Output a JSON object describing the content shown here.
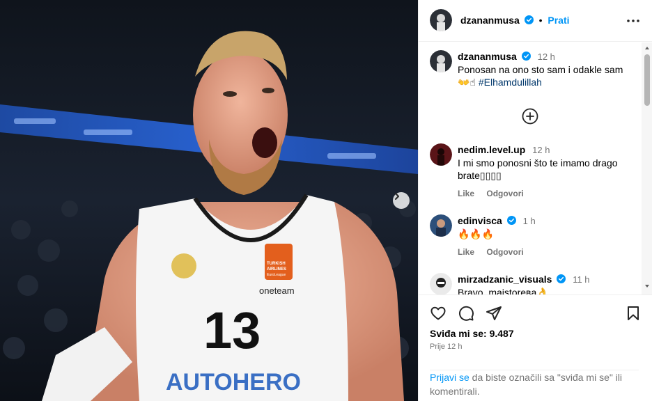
{
  "post": {
    "author": "dzananmusa",
    "follow_label": "Prati",
    "separator": "•",
    "caption_time": "12 h",
    "caption_line1": "Ponosan na ono sto sam i odakle sam",
    "caption_emoji": "👐☝",
    "caption_hashtag": "#Elhamdulillah",
    "media": {
      "jersey_number": "13",
      "sponsor": "AUTOHERO",
      "sponsor2": "oneteam",
      "badge_line1": "TURKISH",
      "badge_line2": "AIRLINES",
      "badge_line3": "EuroLeague"
    }
  },
  "comments": [
    {
      "username": "nedim.level.up",
      "verified": false,
      "time": "12 h",
      "text": "I mi smo ponosni što te imamo drago brate▯▯▯▯",
      "like_label": "Like",
      "reply_label": "Odgovori"
    },
    {
      "username": "edinvisca",
      "verified": true,
      "time": "1 h",
      "text": "🔥🔥🔥",
      "like_label": "Like",
      "reply_label": "Odgovori"
    },
    {
      "username": "mirzadzanic_visuals",
      "verified": true,
      "time": "11 h",
      "text": "Bravo, majstoreвa👌"
    }
  ],
  "actions": {
    "likes_label": "Sviđa mi se: 9.487",
    "posted_ago": "Prije 12 h"
  },
  "login_prompt": {
    "link": "Prijavi se",
    "text": " da biste označili sa \"sviđa mi se\" ili komentirali."
  },
  "colors": {
    "link_blue": "#0095f6",
    "hashtag": "#00376b",
    "muted": "#737373",
    "verified_blue": "#0095f6"
  }
}
